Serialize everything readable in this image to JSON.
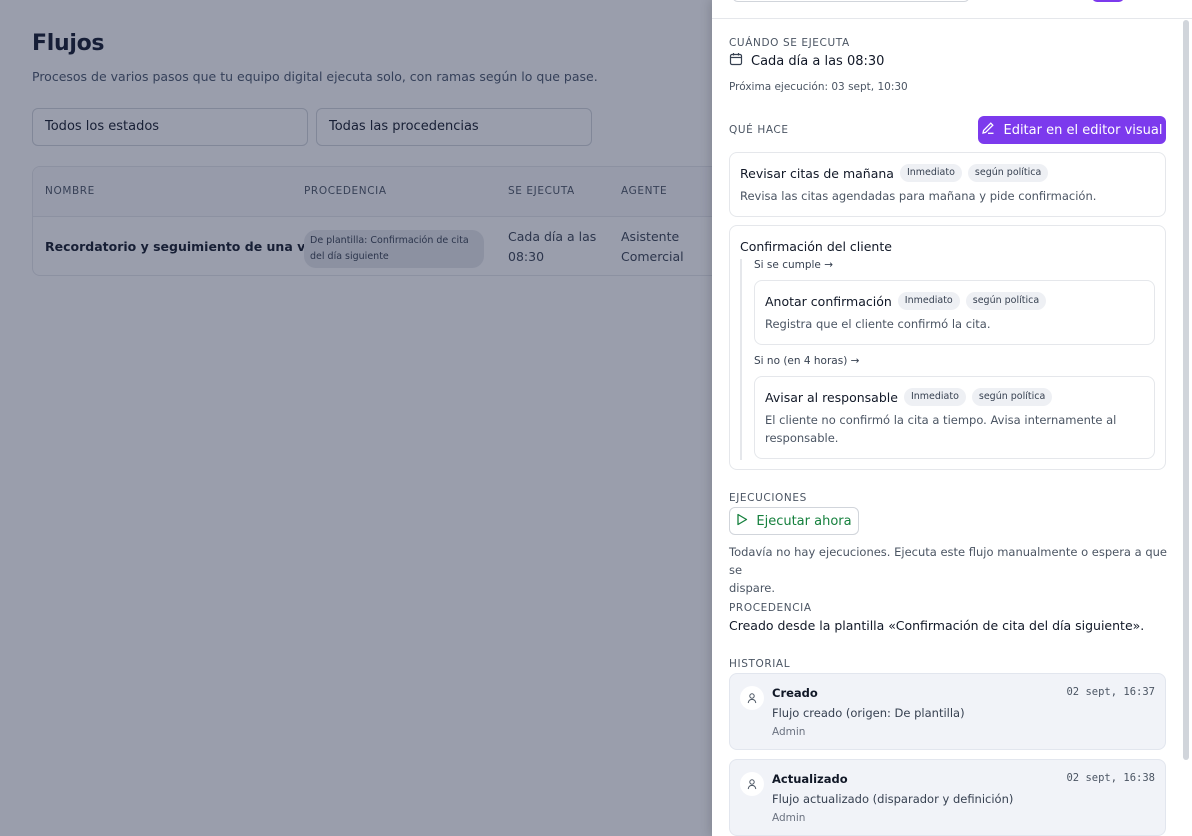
{
  "page": {
    "title": "Flujos",
    "subtitle": "Procesos de varios pasos que tu equipo digital ejecuta solo, con ramas según lo que pase.",
    "filters": [
      "Todos los estados",
      "Todas las procedencias"
    ],
    "table": {
      "headers": [
        "NOMBRE",
        "PROCEDENCIA",
        "SE EJECUTA",
        "AGENTE"
      ],
      "rows": [
        {
          "name": "Recordatorio y seguimiento de una visita",
          "origin": "De plantilla: Confirmación de cita del día siguiente",
          "schedule": "Cada día a las 08:30",
          "agent": "Asistente Comercial"
        }
      ]
    }
  },
  "drawer": {
    "when": {
      "label": "CUÁNDO SE EJECUTA",
      "value": "Cada día a las 08:30",
      "next": "Próxima ejecución: 03 sept, 10:30"
    },
    "what": {
      "label": "QUÉ HACE",
      "edit_button": "Editar en el editor visual",
      "step1": {
        "title": "Revisar citas de mañana",
        "tags": [
          "Inmediato",
          "según política"
        ],
        "desc": "Revisa las citas agendadas para mañana y pide confirmación."
      },
      "condition": {
        "title": "Confirmación del cliente",
        "yes_label": "Si se cumple →",
        "yes_step": {
          "title": "Anotar confirmación",
          "tags": [
            "Inmediato",
            "según política"
          ],
          "desc": "Registra que el cliente confirmó la cita."
        },
        "no_label": "Si no (en 4 horas) →",
        "no_step": {
          "title": "Avisar al responsable",
          "tags": [
            "Inmediato",
            "según política"
          ],
          "desc_line1": "El cliente no confirmó la cita a tiempo. Avisa internamente al",
          "desc_line2": "responsable."
        }
      }
    },
    "runs": {
      "label": "EJECUCIONES",
      "button": "Ejecutar ahora",
      "empty_line1": "Todavía no hay ejecuciones. Ejecuta este flujo manualmente o espera a que se",
      "empty_line2": "dispare."
    },
    "origin": {
      "label": "PROCEDENCIA",
      "text": "Creado desde la plantilla «Confirmación de cita del día siguiente»."
    },
    "history": {
      "label": "HISTORIAL",
      "items": [
        {
          "title": "Creado",
          "text": "Flujo creado (origen: De plantilla)",
          "user": "Admin",
          "time": "02 sept, 16:37"
        },
        {
          "title": "Actualizado",
          "text": "Flujo actualizado (disparador y definición)",
          "user": "Admin",
          "time": "02 sept, 16:38"
        }
      ]
    }
  },
  "colors": {
    "accent": "#7c3aed",
    "run_green": "#15803d",
    "overlay": "#1e2946"
  }
}
